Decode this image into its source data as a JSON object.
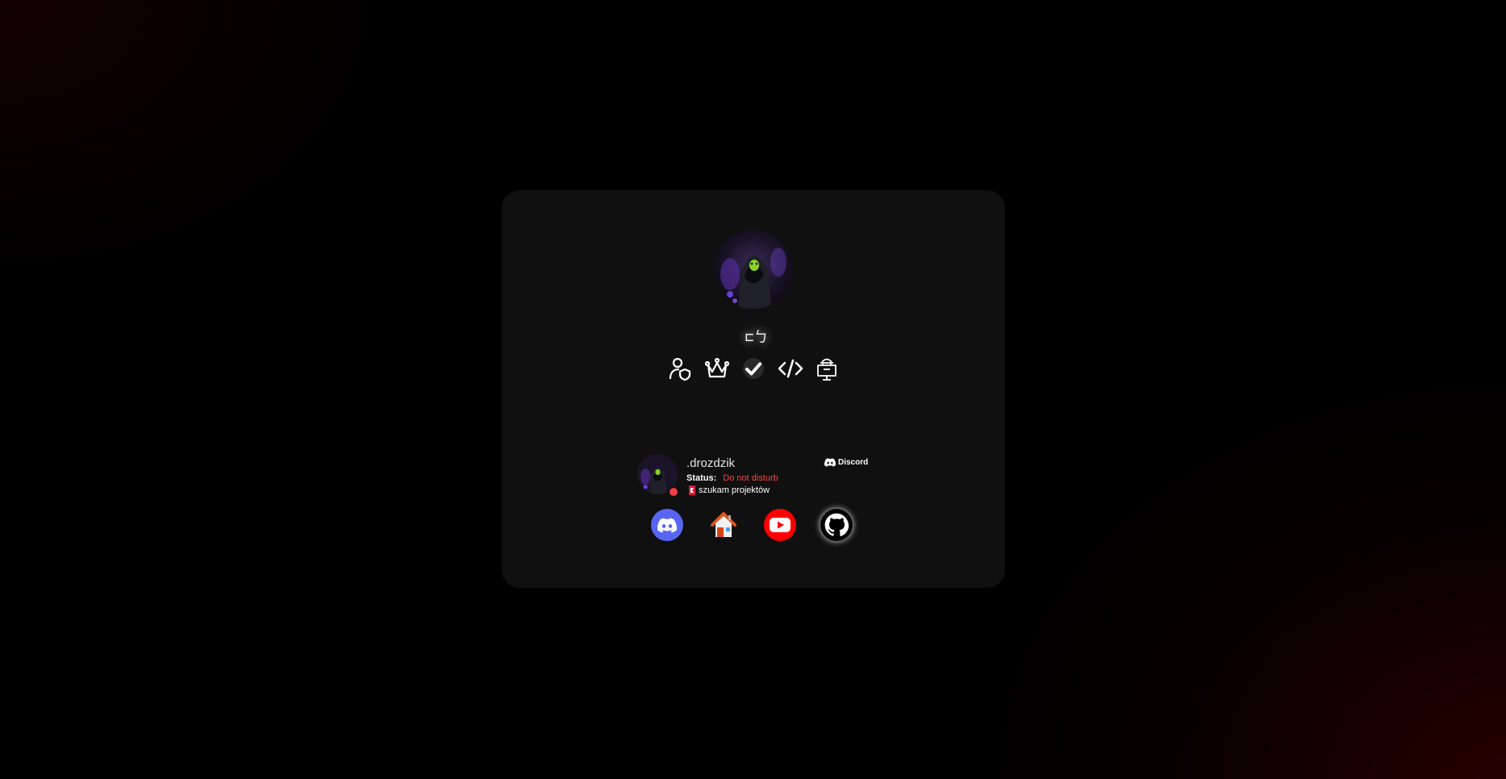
{
  "profile": {
    "username_glyph": "⊏ㄅ",
    "avatar_alt": "profile avatar",
    "badges": [
      {
        "icon": "user-shield-icon"
      },
      {
        "icon": "crown-icon"
      },
      {
        "icon": "verified-check-icon"
      },
      {
        "icon": "code-icon"
      },
      {
        "icon": "hacker-desk-icon"
      }
    ]
  },
  "presence": {
    "name": ".drozdzik",
    "status_label": "Status:",
    "status_value": "Do not disturb",
    "status_color": "#f04747",
    "activity": "szukam projektów",
    "platform": "Discord"
  },
  "socials": [
    {
      "name": "Discord",
      "icon": "discord-icon",
      "color": "#5865f2"
    },
    {
      "name": "Home",
      "icon": "house-icon",
      "color": "#ffffff"
    },
    {
      "name": "YouTube",
      "icon": "youtube-icon",
      "color": "#ff0000"
    },
    {
      "name": "GitHub",
      "icon": "github-icon",
      "color": "#000000"
    }
  ],
  "colors": {
    "card_bg": "#101010",
    "page_bg": "#000000",
    "accent_red": "#3a0000"
  }
}
